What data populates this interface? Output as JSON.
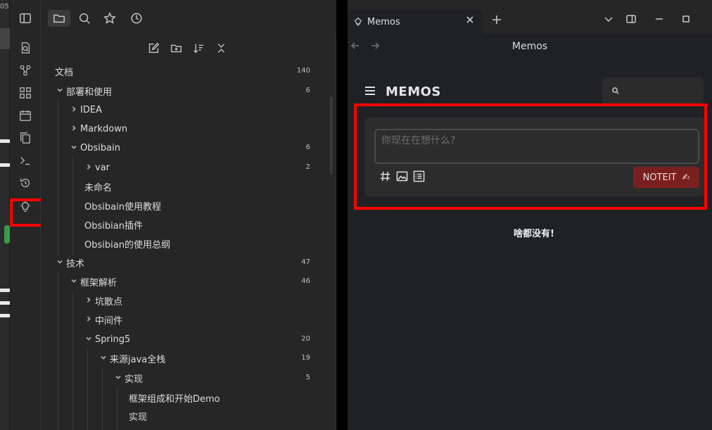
{
  "external": {
    "edge_text": "05"
  },
  "explorer": {
    "root": {
      "label": "文档",
      "count": "140"
    },
    "items": [
      {
        "label": "部署和使用",
        "count": "6"
      },
      {
        "label": "IDEA",
        "count": ""
      },
      {
        "label": "Markdown",
        "count": ""
      },
      {
        "label": "Obsibain",
        "count": "6"
      },
      {
        "label": "var",
        "count": "2"
      },
      {
        "label": "未命名",
        "count": ""
      },
      {
        "label": "Obsibain使用教程",
        "count": ""
      },
      {
        "label": "Obsibian插件",
        "count": ""
      },
      {
        "label": "Obsibian的使用总纲",
        "count": ""
      },
      {
        "label": "技术",
        "count": "47"
      },
      {
        "label": "框架解析",
        "count": "46"
      },
      {
        "label": "坑散点",
        "count": ""
      },
      {
        "label": "中间件",
        "count": ""
      },
      {
        "label": "Spring5",
        "count": "20"
      },
      {
        "label": "来源java全栈",
        "count": "19"
      },
      {
        "label": "实现",
        "count": "5"
      },
      {
        "label": "框架组成和开始Demo",
        "count": ""
      },
      {
        "label": "实现",
        "count": ""
      }
    ]
  },
  "tab": {
    "title": "Memos"
  },
  "view": {
    "title": "Memos"
  },
  "memos": {
    "title": "MEMOS",
    "editor_placeholder": "你现在在想什么?",
    "submit_label": "NOTEIT",
    "submit_emoji": "✍",
    "empty_message": "啥都没有!"
  },
  "colors": {
    "highlight": "#ff0000",
    "submit_button": "#7a1f1f",
    "sidebar_bg": "#262626",
    "pane_bg": "#1f2125"
  }
}
